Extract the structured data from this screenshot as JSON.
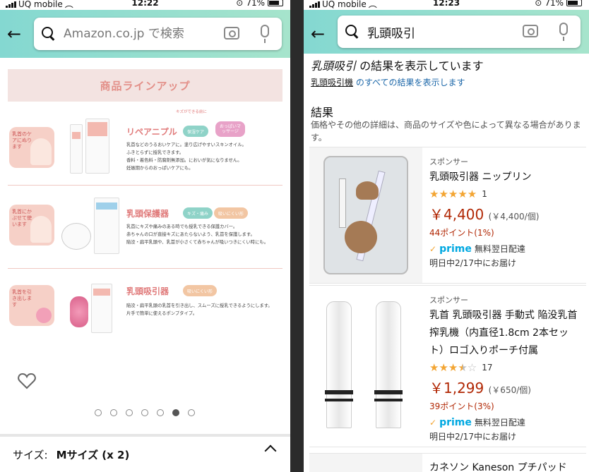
{
  "left_screen": {
    "status": {
      "carrier": "UQ mobile",
      "time": "12:22",
      "battery": "71%"
    },
    "search": {
      "placeholder": "Amazon.co.jp で検索"
    },
    "lineup_title": "商品ラインアップ",
    "products": [
      {
        "bubble": "乳首のケアにぬります",
        "title": "リペアニプル",
        "tags": [
          "保湿ケア",
          "おっぱいマッサージ"
        ],
        "tag_note": "キズができる前に",
        "desc": "乳首などのうるおいケアに。塗り広げやすいスキンオイル。\nふきとらずに授乳できます。\n香料・着色料・防腐剤無添加。においが気になりません。\n妊娠期からのおっぱいケアにも。"
      },
      {
        "bubble": "乳首にかぶせて使います",
        "title": "乳頭保護器",
        "tags": [
          "キズ・痛み",
          "吸いにくい形"
        ],
        "desc": "乳首にキズや痛みのある時でも授乳できる保護カバー。\n赤ちゃんの口が直接キズにあたらないよう、乳首を保護します。\n陥没・扁平乳頭や、乳首が小さくて赤ちゃんが吸いつきにくい時にも。"
      },
      {
        "bubble": "乳首を引き出します",
        "title": "乳頭吸引器",
        "tags": [
          "吸いにくい形"
        ],
        "desc": "陥没・扁平乳頭の乳首を引き出し、スムーズに授乳できるようにします。\n片手で簡単に使えるポンプタイプ。"
      }
    ],
    "carousel": {
      "count": 7,
      "active": 5
    },
    "size_label": "サイズ:",
    "size_value": "Mサイズ (x 2)"
  },
  "right_screen": {
    "status": {
      "carrier": "UQ mobile",
      "time": "12:23",
      "battery": "71%"
    },
    "search": {
      "value": "乳頭吸引"
    },
    "result_note_query": "乳頭吸引",
    "result_note_rest": " の結果を表示しています",
    "alt_query": "乳頭吸引機",
    "alt_rest": " のすべての結果を表示します",
    "section_title": "結果",
    "section_sub": "価格やその他の詳細は、商品のサイズや色によって異なる場合があります。",
    "results": [
      {
        "sponsor": "スポンサー",
        "name": "乳頭吸引器 ニップリン",
        "rating": 5,
        "reviews": "1",
        "price": "￥4,400",
        "unit": "(￥4,400/個)",
        "points": "44ポイント(1%)",
        "prime_label": "prime",
        "shipping": "無料翌日配達",
        "delivery": "明日中2/17中にお届け"
      },
      {
        "sponsor": "スポンサー",
        "name": "乳首 乳頭吸引器 手動式 陥没乳首 搾乳機（内直径1.8cm 2本セット）ロゴ入りポーチ付属",
        "rating": 3.5,
        "reviews": "17",
        "price": "￥1,299",
        "unit": "(￥650/個)",
        "points": "39ポイント(3%)",
        "prime_label": "prime",
        "shipping": "無料翌日配達",
        "delivery": "明日中2/17中にお届け"
      },
      {
        "name": "カネソン Kaneson プチパッド"
      }
    ]
  }
}
